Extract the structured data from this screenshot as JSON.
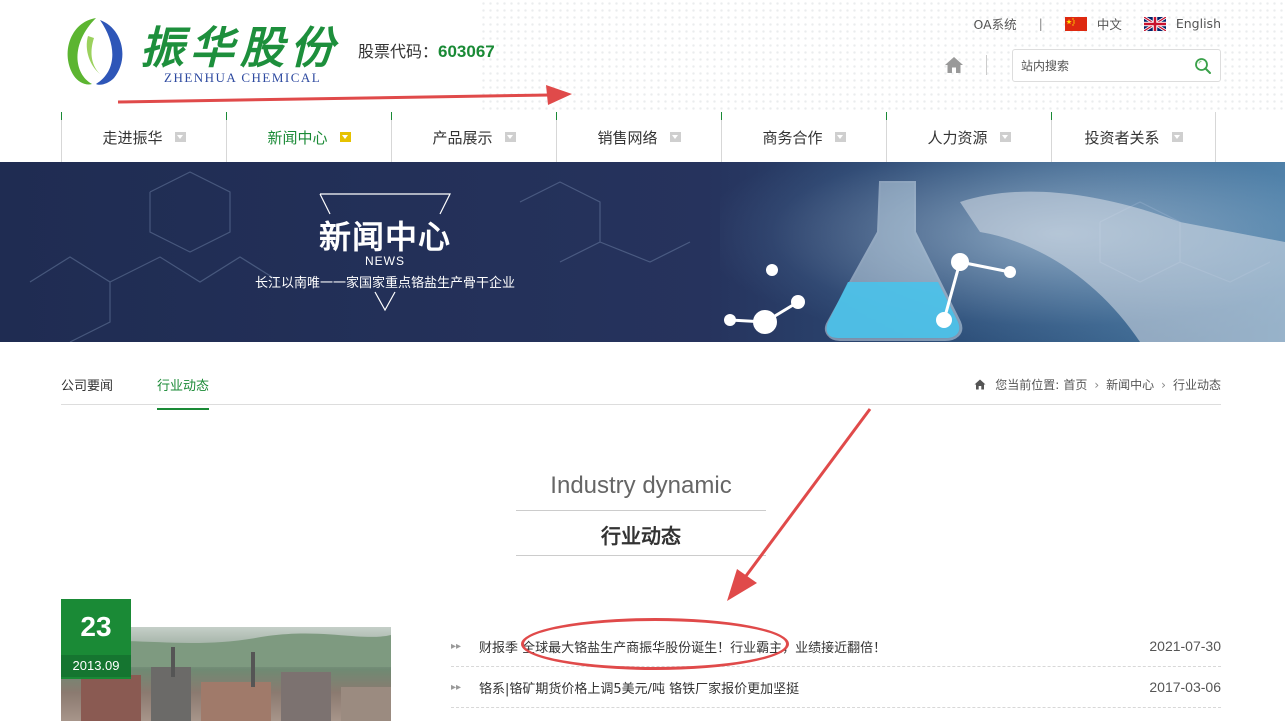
{
  "header": {
    "logo_cn": "振华股份",
    "logo_en": "ZHENHUA CHEMICAL",
    "stock_label": "股票代码：",
    "stock_code": "603067",
    "oa_link": "OA系统",
    "top_separator": "|",
    "lang_cn": "中文",
    "lang_en": "English",
    "search_placeholder": "站内搜索"
  },
  "nav": {
    "items": [
      {
        "label": "走进振华"
      },
      {
        "label": "新闻中心",
        "active": true
      },
      {
        "label": "产品展示"
      },
      {
        "label": "销售网络"
      },
      {
        "label": "商务合作"
      },
      {
        "label": "人力资源"
      },
      {
        "label": "投资者关系"
      }
    ]
  },
  "banner": {
    "title": "新闻中心",
    "subtitle": "NEWS",
    "description": "长江以南唯一一家国家重点铬盐生产骨干企业"
  },
  "subnav": {
    "tabs": [
      {
        "label": "公司要闻"
      },
      {
        "label": "行业动态",
        "active": true
      }
    ],
    "breadcrumb_prefix": "您当前位置:",
    "breadcrumb": [
      "首页",
      "新闻中心",
      "行业动态"
    ]
  },
  "section": {
    "title_en": "Industry dynamic",
    "title_cn": "行业动态"
  },
  "feature": {
    "day": "23",
    "year_month": "2013.09"
  },
  "news": [
    {
      "title": "财报季 全球最大铬盐生产商振华股份诞生！行业霸主，业绩接近翻倍！",
      "date": "2021-07-30"
    },
    {
      "title": "铬系|铬矿期货价格上调5美元/吨 铬铁厂家报价更加坚挺",
      "date": "2017-03-06"
    }
  ],
  "colors": {
    "brand_green": "#1a8a36",
    "annotation_red": "#e04a4a",
    "banner_navy": "#1f2c52"
  }
}
